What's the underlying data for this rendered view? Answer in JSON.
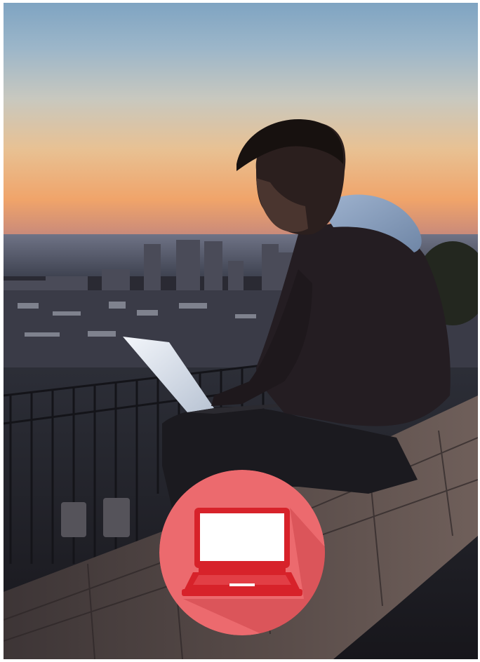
{
  "photo": {
    "subject": "person",
    "object": "laptop",
    "setting": "rooftop-city-skyline"
  },
  "badge": {
    "icon": "laptop-icon",
    "circle_color": "#ec6a6e",
    "icon_color": "#d7222a",
    "screen_color": "#ffffff"
  }
}
